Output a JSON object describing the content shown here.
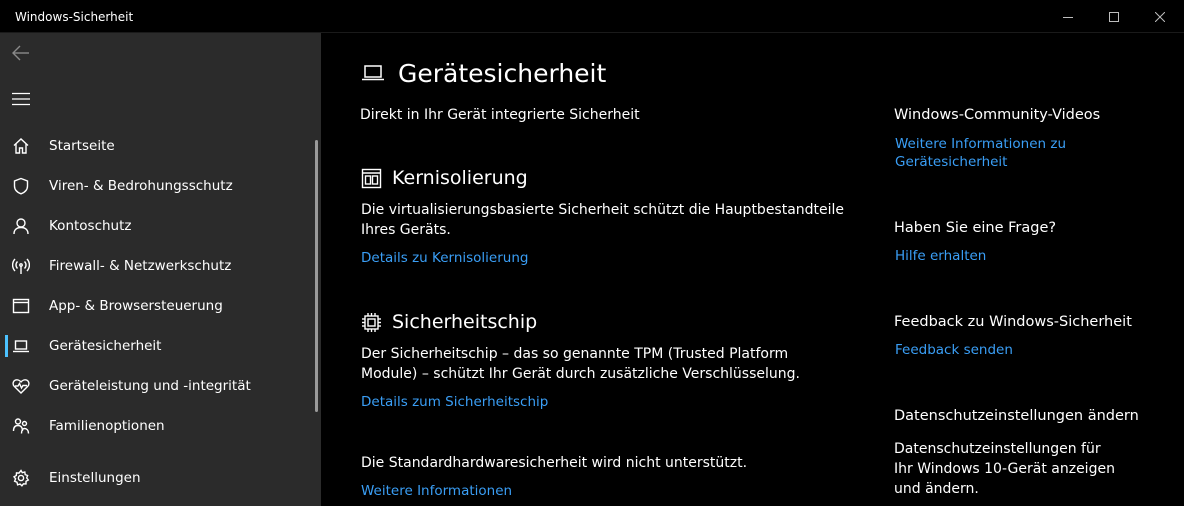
{
  "window": {
    "title": "Windows-Sicherheit"
  },
  "sidebar": {
    "items": [
      {
        "label": "Startseite",
        "icon": "home-icon"
      },
      {
        "label": "Viren- & Bedrohungsschutz",
        "icon": "shield-icon"
      },
      {
        "label": "Kontoschutz",
        "icon": "person-icon"
      },
      {
        "label": "Firewall- & Netzwerkschutz",
        "icon": "wifi-antenna-icon"
      },
      {
        "label": "App- & Browsersteuerung",
        "icon": "app-window-icon"
      },
      {
        "label": "Gerätesicherheit",
        "icon": "laptop-icon",
        "active": true
      },
      {
        "label": "Geräteleistung und -integrität",
        "icon": "heart-icon"
      },
      {
        "label": "Familienoptionen",
        "icon": "family-icon"
      }
    ],
    "settings_label": "Einstellungen"
  },
  "main": {
    "title": "Gerätesicherheit",
    "subtitle": "Direkt in Ihr Gerät integrierte Sicherheit",
    "sections": [
      {
        "title": "Kernisolierung",
        "text": "Die virtualisierungsbasierte Sicherheit schützt die Hauptbestandteile Ihres Geräts.",
        "link": "Details zu Kernisolierung"
      },
      {
        "title": "Sicherheitschip",
        "text": "Der Sicherheitschip – das so genannte TPM (Trusted Platform Module) – schützt Ihr Gerät durch zusätzliche Verschlüsselung.",
        "link": "Details zum Sicherheitschip"
      }
    ],
    "hardware_text": "Die Standardhardwaresicherheit wird nicht unterstützt.",
    "hardware_link": "Weitere Informationen"
  },
  "right": {
    "community_heading": "Windows-Community-Videos",
    "community_link": "Weitere Informationen zu Gerätesicherheit",
    "question_heading": "Haben Sie eine Frage?",
    "question_link": "Hilfe erhalten",
    "feedback_heading": "Feedback zu Windows-Sicherheit",
    "feedback_link": "Feedback senden",
    "privacy_heading": "Datenschutzeinstellungen ändern",
    "privacy_text": "Datenschutzeinstellungen für Ihr Windows 10-Gerät anzeigen und ändern."
  },
  "colors": {
    "sidebar_bg": "#2b2b2b",
    "accent": "#4cc2ff",
    "link": "#3a9ef5",
    "background": "#000000"
  }
}
